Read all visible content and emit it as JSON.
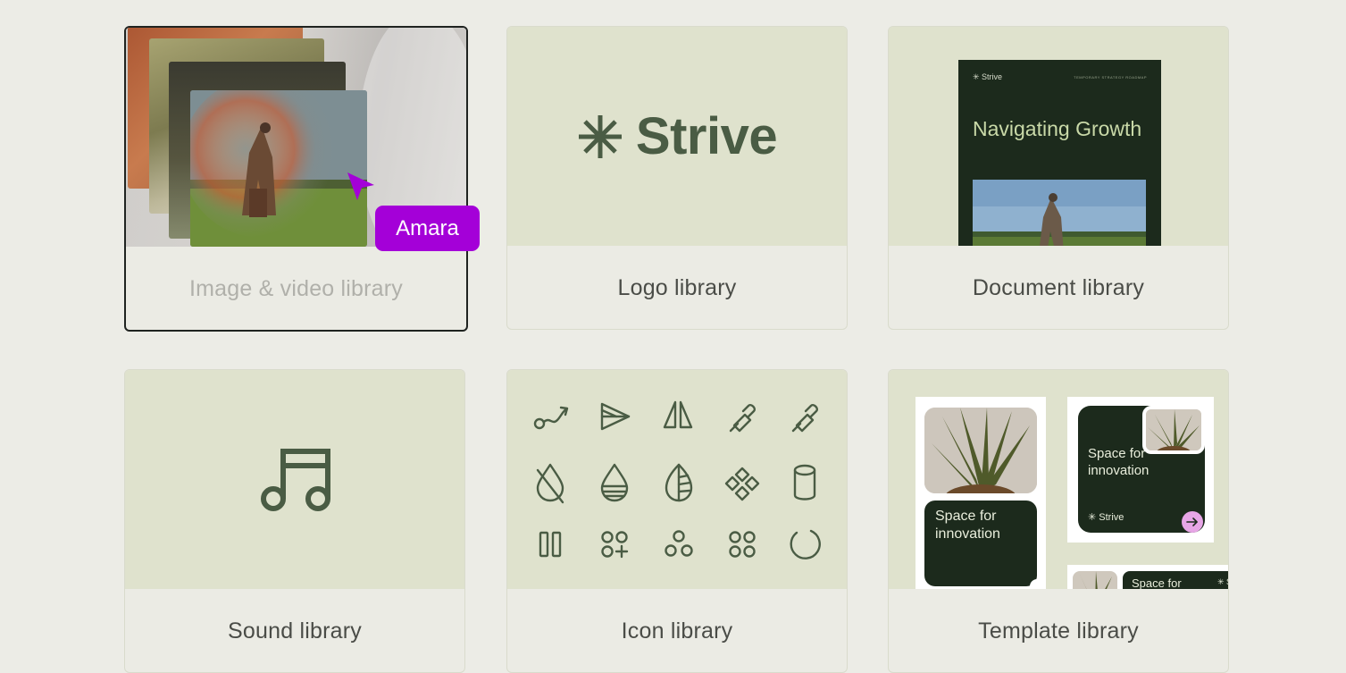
{
  "cards": [
    {
      "label": "Image & video library"
    },
    {
      "label": "Logo library"
    },
    {
      "label": "Document library"
    },
    {
      "label": "Sound library"
    },
    {
      "label": "Icon library"
    },
    {
      "label": "Template library"
    }
  ],
  "logo": {
    "brand": "Strive",
    "icon": "asterisk-icon"
  },
  "document": {
    "brand": "✳ Strive",
    "meta": "TEMPORARY STRATEGY ROADMAP",
    "title": "Navigating Growth"
  },
  "sound": {
    "icon": "music-note-icon"
  },
  "template": {
    "card1_text": "Space for innovation",
    "card2_text": "Space for innovation",
    "card2_brand": "✳ Strive",
    "card3_text": "Space for",
    "card3_brand": "✳ S"
  },
  "collaborator": {
    "name": "Amara",
    "color": "#a400d8"
  },
  "colors": {
    "background": "#ecece6",
    "thumb": "#dfe2cd",
    "logo_green": "#4a5c44",
    "dark_green": "#1c2a1c",
    "cursor": "#a400d8"
  }
}
